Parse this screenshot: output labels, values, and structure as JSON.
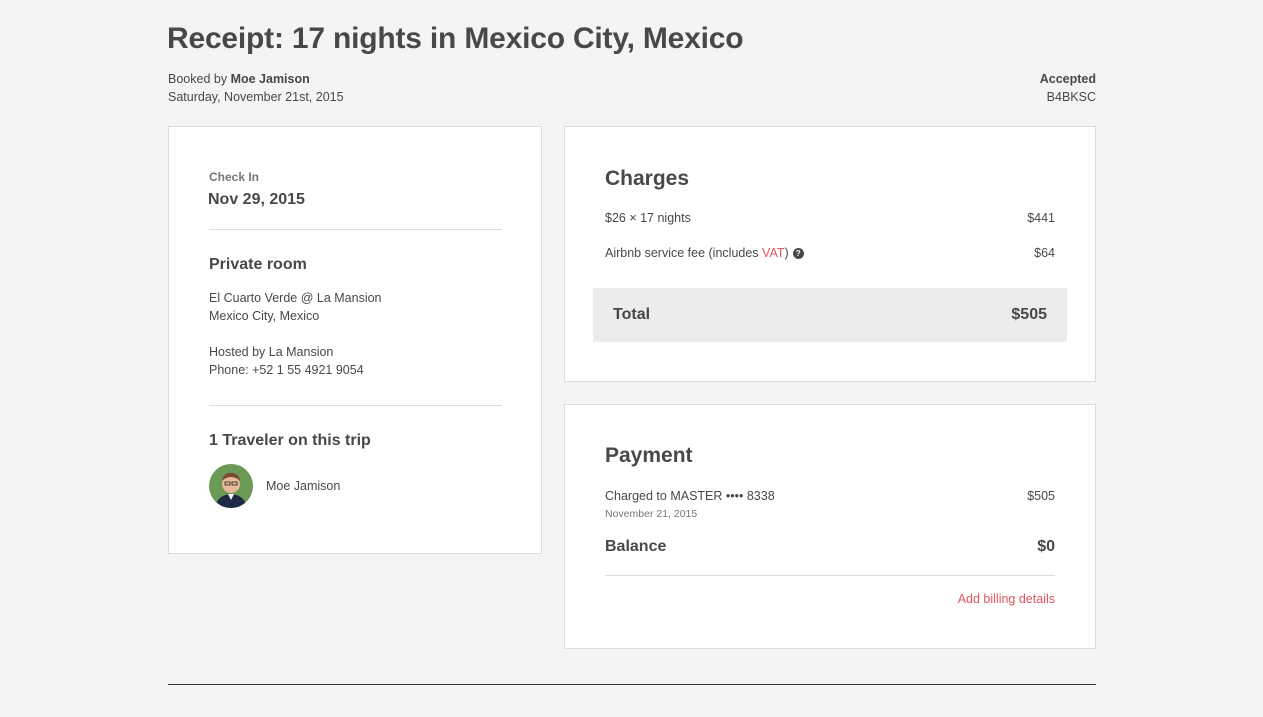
{
  "header": {
    "title": "Receipt: 17 nights in Mexico City, Mexico",
    "booked_by_label": "Booked by",
    "booked_by_name": "Moe Jamison",
    "date": "Saturday, November 21st, 2015",
    "status": "Accepted",
    "confirmation_code": "B4BKSC"
  },
  "trip": {
    "check_in_label": "Check In",
    "check_in_date": "Nov 29, 2015",
    "room_type": "Private room",
    "listing_name": "El Cuarto Verde @ La Mansion",
    "listing_location": "Mexico City, Mexico",
    "host_line": "Hosted by La Mansion",
    "phone_line": "Phone: +52 1 55 4921 9054",
    "travelers_heading": "1 Traveler on this trip",
    "traveler_name": "Moe Jamison"
  },
  "charges": {
    "heading": "Charges",
    "nightly_label": "$26 × 17 nights",
    "nightly_amount": "$441",
    "fee_label_prefix": "Airbnb service fee (includes ",
    "fee_label_vat": "VAT",
    "fee_label_suffix": ")",
    "fee_help_icon": "?",
    "fee_amount": "$64",
    "total_label": "Total",
    "total_amount": "$505"
  },
  "payment": {
    "heading": "Payment",
    "charged_label": "Charged to MASTER •••• 8338",
    "charged_date": "November 21, 2015",
    "charged_amount": "$505",
    "balance_label": "Balance",
    "balance_amount": "$0",
    "add_billing_link": "Add billing details"
  },
  "colors": {
    "accent": "#e0565b",
    "text": "#484848",
    "background": "#f4f4f4",
    "total_bg": "#ecedea"
  }
}
